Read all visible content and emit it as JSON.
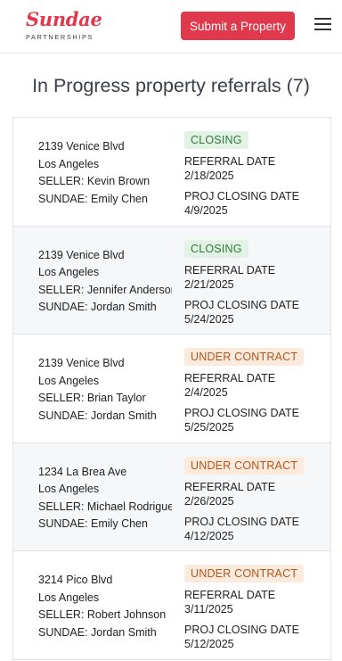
{
  "brand": {
    "name": "Sundae",
    "tagline": "PARTNERSHIPS"
  },
  "header": {
    "submit_label": "Submit a Property",
    "menu_icon": "hamburger-menu-icon"
  },
  "page": {
    "title": "In Progress property referrals (7)"
  },
  "labels": {
    "referral_date": "REFERRAL DATE",
    "proj_closing_date": "PROJ CLOSING DATE"
  },
  "colors": {
    "brand": "#e0384c",
    "closing_badge_bg": "#e2f2e4",
    "closing_badge_text": "#2e7a3a",
    "contract_badge_bg": "#fcebdd",
    "contract_badge_text": "#b4551c"
  },
  "referrals": [
    {
      "address": "2139 Venice Blvd",
      "city": "Los Angeles",
      "seller": "SELLER: Kevin Brown",
      "sundae": "SUNDAE: Emily Chen",
      "status": "CLOSING",
      "referral_date": "2/18/2025",
      "proj_closing_date": "4/9/2025"
    },
    {
      "address": "2139 Venice Blvd",
      "city": "Los Angeles",
      "seller": "SELLER: Jennifer Anderson",
      "sundae": "SUNDAE: Jordan Smith",
      "status": "CLOSING",
      "referral_date": "2/21/2025",
      "proj_closing_date": "5/24/2025"
    },
    {
      "address": "2139 Venice Blvd",
      "city": "Los Angeles",
      "seller": "SELLER: Brian Taylor",
      "sundae": "SUNDAE: Jordan Smith",
      "status": "UNDER CONTRACT",
      "referral_date": "2/4/2025",
      "proj_closing_date": "5/25/2025"
    },
    {
      "address": "1234 La Brea Ave",
      "city": "Los Angeles",
      "seller": "SELLER: Michael Rodriguez",
      "sundae": "SUNDAE: Emily Chen",
      "status": "UNDER CONTRACT",
      "referral_date": "2/26/2025",
      "proj_closing_date": "4/12/2025"
    },
    {
      "address": "3214 Pico Blvd",
      "city": "Los Angeles",
      "seller": "SELLER: Robert Johnson",
      "sundae": "SUNDAE: Jordan Smith",
      "status": "UNDER CONTRACT",
      "referral_date": "3/11/2025",
      "proj_closing_date": "5/12/2025"
    }
  ]
}
